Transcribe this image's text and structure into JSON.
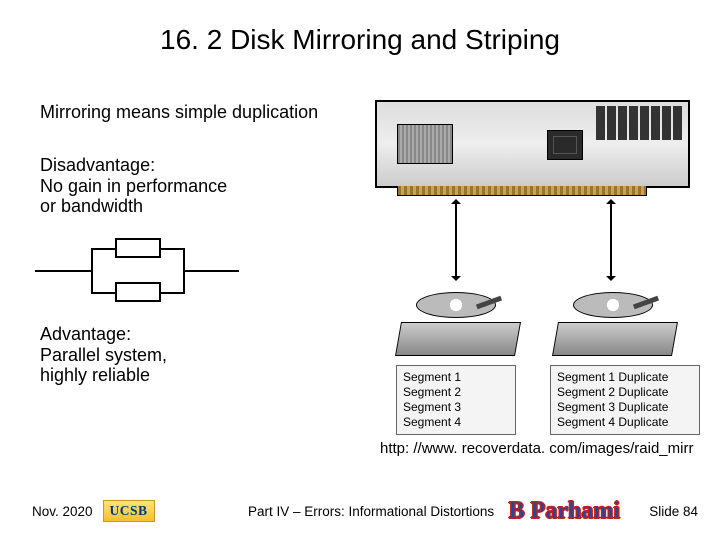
{
  "title": "16. 2  Disk Mirroring and Striping",
  "mirroring_def": "Mirroring means simple duplication",
  "disadvantage": {
    "heading": "Disadvantage:",
    "line1": "No gain in performance",
    "line2": "or bandwidth"
  },
  "advantage": {
    "heading": "Advantage:",
    "line1": "Parallel system,",
    "line2": "highly reliable"
  },
  "segments_left": [
    "Segment 1",
    "Segment 2",
    "Segment 3",
    "Segment 4"
  ],
  "segments_right": [
    "Segment 1 Duplicate",
    "Segment 2 Duplicate",
    "Segment 3 Duplicate",
    "Segment 4 Duplicate"
  ],
  "url": "http: //www. recoverdata. com/images/raid_mirr",
  "footer": {
    "date": "Nov. 2020",
    "logo": "UCSB",
    "part": "Part IV – Errors: Informational Distortions",
    "author": "B Parhami",
    "slide": "Slide 84"
  }
}
